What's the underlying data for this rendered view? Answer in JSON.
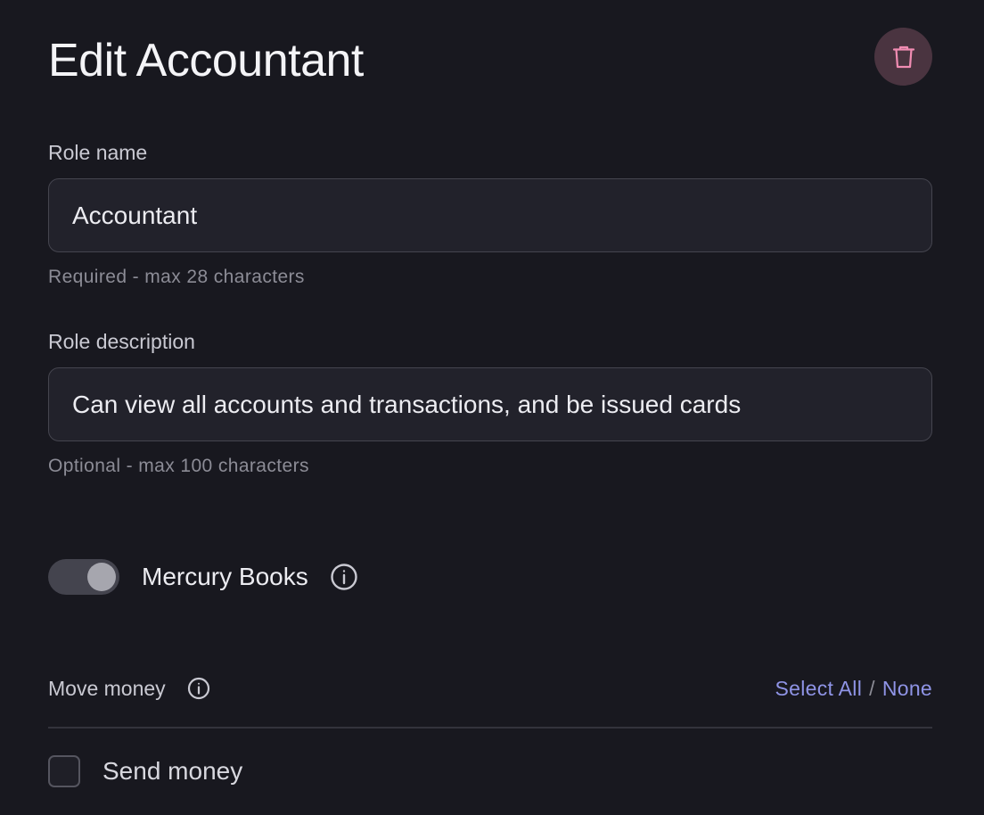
{
  "header": {
    "title": "Edit Accountant",
    "delete_icon": "trash-icon"
  },
  "role_name": {
    "label": "Role name",
    "value": "Accountant",
    "hint": "Required - max 28 characters"
  },
  "role_description": {
    "label": "Role description",
    "value": "Can view all accounts and transactions, and be issued cards",
    "hint": "Optional - max 100 characters"
  },
  "mercury_books": {
    "label": "Mercury Books",
    "enabled": true,
    "info_icon": "info-icon"
  },
  "move_money": {
    "title": "Move money",
    "info_icon": "info-icon",
    "select_all": "Select All",
    "separator": "/",
    "select_none": "None",
    "items": [
      {
        "label": "Send money",
        "checked": false
      }
    ]
  },
  "colors": {
    "background": "#18181f",
    "link": "#8f94e6",
    "delete_bg": "#4a3440",
    "delete_icon": "#f08cb2"
  }
}
